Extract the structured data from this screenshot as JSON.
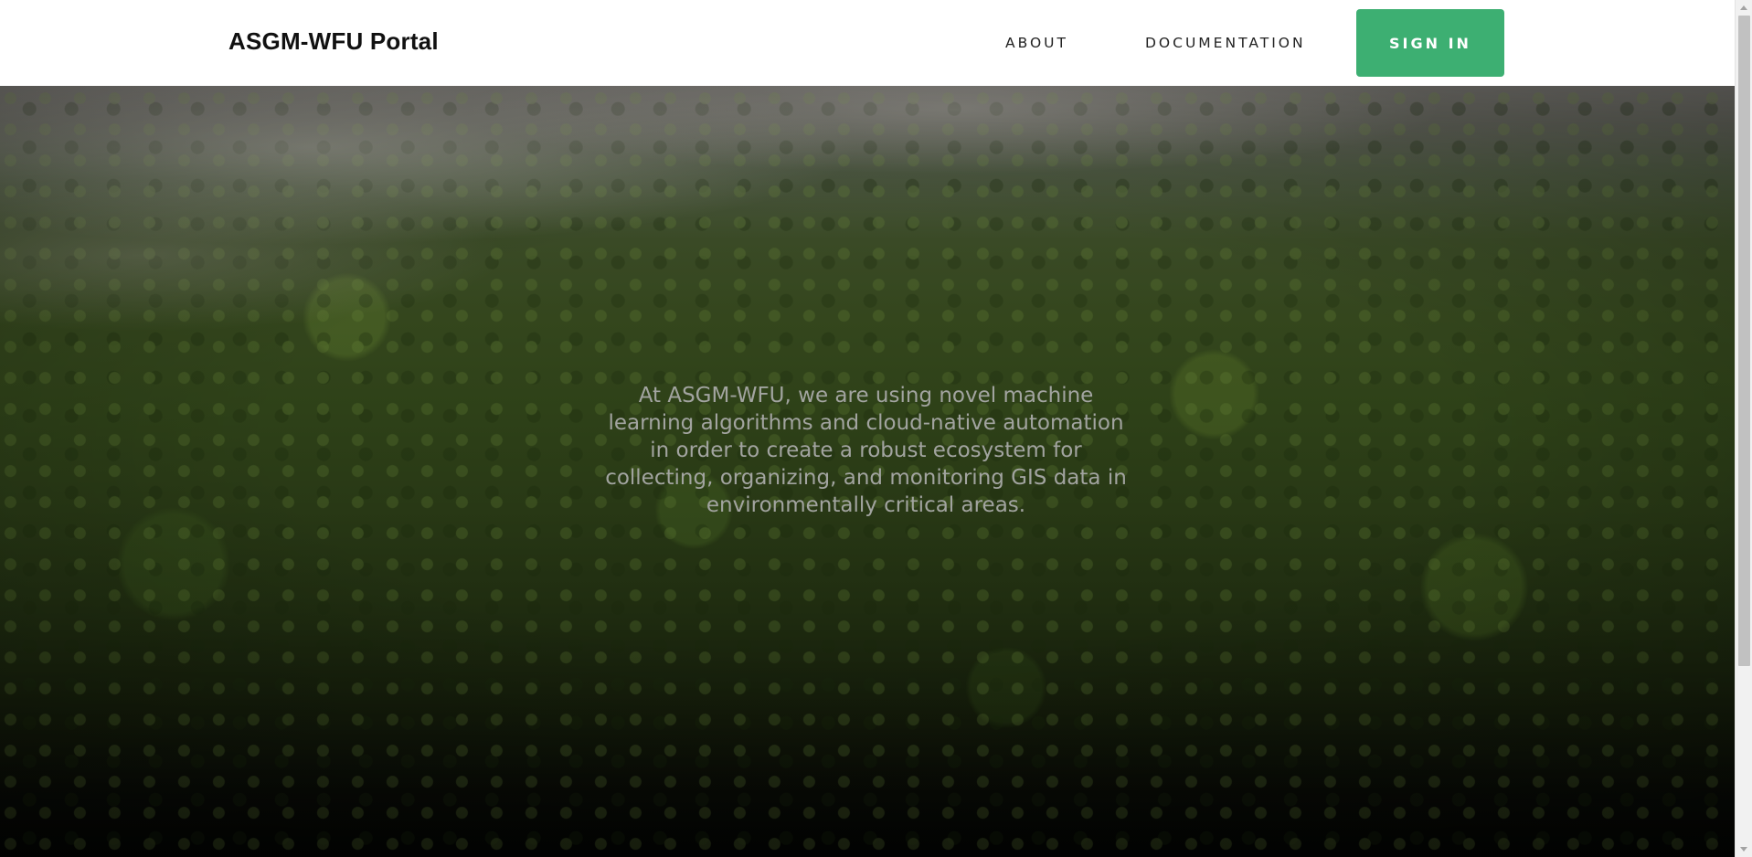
{
  "header": {
    "brand": "ASGM-WFU Portal",
    "nav": {
      "about": "ABOUT",
      "documentation": "DOCUMENTATION"
    },
    "sign_in_label": "SIGN IN"
  },
  "hero": {
    "text": "At ASGM-WFU, we are using novel machine learning algorithms and cloud-native automation in order to create a robust ecosystem for collecting, organizing, and monitoring GIS data in environmentally critical areas."
  },
  "colors": {
    "accent": "#3daf72",
    "header_background": "#ffffff",
    "hero_text": "#a2a4a0"
  },
  "icons": {
    "scroll_up": "scroll-up-arrow-icon",
    "scroll_down": "scroll-down-arrow-icon"
  }
}
